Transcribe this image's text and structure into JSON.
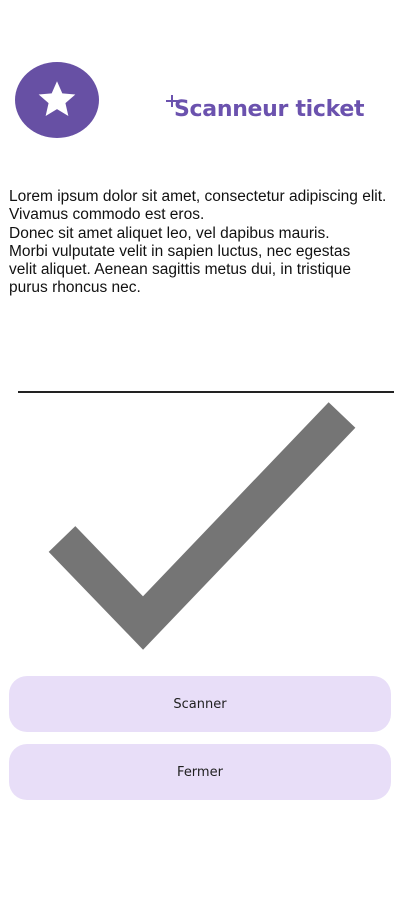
{
  "header": {
    "logo_icon": "star-icon",
    "title": "Scanneur ticket",
    "title_prefix_icon": "plus-icon"
  },
  "description": {
    "lines": [
      "Lorem ipsum dolor sit amet, consectetur adipiscing elit.",
      "Vivamus commodo est eros.",
      "Donec sit amet aliquet leo, vel dapibus mauris.",
      "Morbi vulputate velit in sapien luctus, nec egestas",
      "velit aliquet. Aenean sagittis metus dui, in tristique",
      "purus rhoncus nec."
    ]
  },
  "result": {
    "icon": "checkmark-icon"
  },
  "actions": {
    "scan_label": "Scanner",
    "close_label": "Fermer"
  },
  "colors": {
    "accent": "#6750a4",
    "title": "#6b52ae",
    "button_bg": "#e8def8",
    "checkmark": "#757575",
    "divider": "#222222"
  }
}
